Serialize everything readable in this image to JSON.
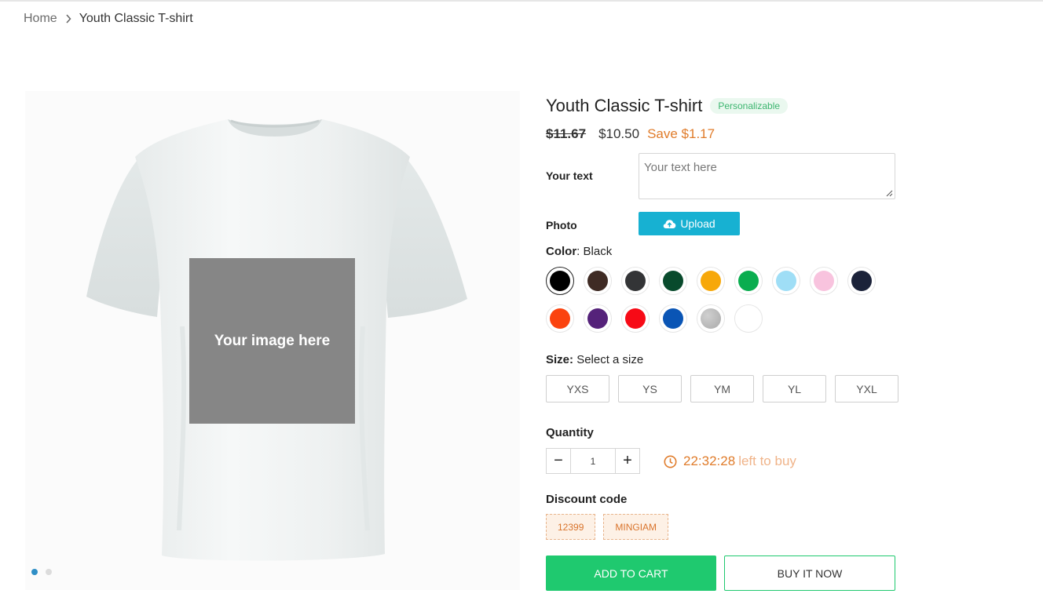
{
  "breadcrumb": {
    "home": "Home",
    "current": "Youth Classic T-shirt"
  },
  "gallery": {
    "placeholder_text": "Your image here",
    "slides": 2,
    "active_slide": 1
  },
  "product": {
    "title": "Youth Classic T-shirt",
    "badge": "Personalizable",
    "old_price": "$11.67",
    "price": "$10.50",
    "save": "Save $1.17"
  },
  "personalization": {
    "text_label": "Your text",
    "text_placeholder": "Your text here",
    "photo_label": "Photo",
    "upload_label": "Upload"
  },
  "color": {
    "label": "Color",
    "selected": "Black",
    "swatches": [
      {
        "name": "Black",
        "hex": "#000000"
      },
      {
        "name": "Brown",
        "hex": "#3f2b24"
      },
      {
        "name": "Dark Gray",
        "hex": "#333436"
      },
      {
        "name": "Forest Green",
        "hex": "#084a2c"
      },
      {
        "name": "Gold",
        "hex": "#f7a80a"
      },
      {
        "name": "Green",
        "hex": "#0aad4f"
      },
      {
        "name": "Light Blue",
        "hex": "#9fdef6"
      },
      {
        "name": "Light Pink",
        "hex": "#f8c3de"
      },
      {
        "name": "Navy",
        "hex": "#1b2239"
      },
      {
        "name": "Orange",
        "hex": "#fb430f"
      },
      {
        "name": "Purple",
        "hex": "#55227a"
      },
      {
        "name": "Red",
        "hex": "#f70a16"
      },
      {
        "name": "Royal Blue",
        "hex": "#0a55b5"
      },
      {
        "name": "Sport Grey",
        "hex": "#b9b9b9"
      },
      {
        "name": "White",
        "hex": "#ffffff"
      }
    ]
  },
  "size": {
    "label": "Size:",
    "hint": "Select a size",
    "options": [
      "YXS",
      "YS",
      "YM",
      "YL",
      "YXL"
    ]
  },
  "quantity": {
    "label": "Quantity",
    "value": "1",
    "minus": "−",
    "plus": "+"
  },
  "timer": {
    "time": "22:32:28",
    "suffix": "left to buy"
  },
  "discount": {
    "label": "Discount code",
    "codes": [
      "12399",
      "MINGIAM"
    ]
  },
  "actions": {
    "add_to_cart": "ADD TO CART",
    "buy_now": "BUY IT NOW"
  },
  "colors": {
    "accent_orange": "#e07c2b",
    "upload_blue": "#17b1d2",
    "cart_green": "#1fc96f"
  }
}
